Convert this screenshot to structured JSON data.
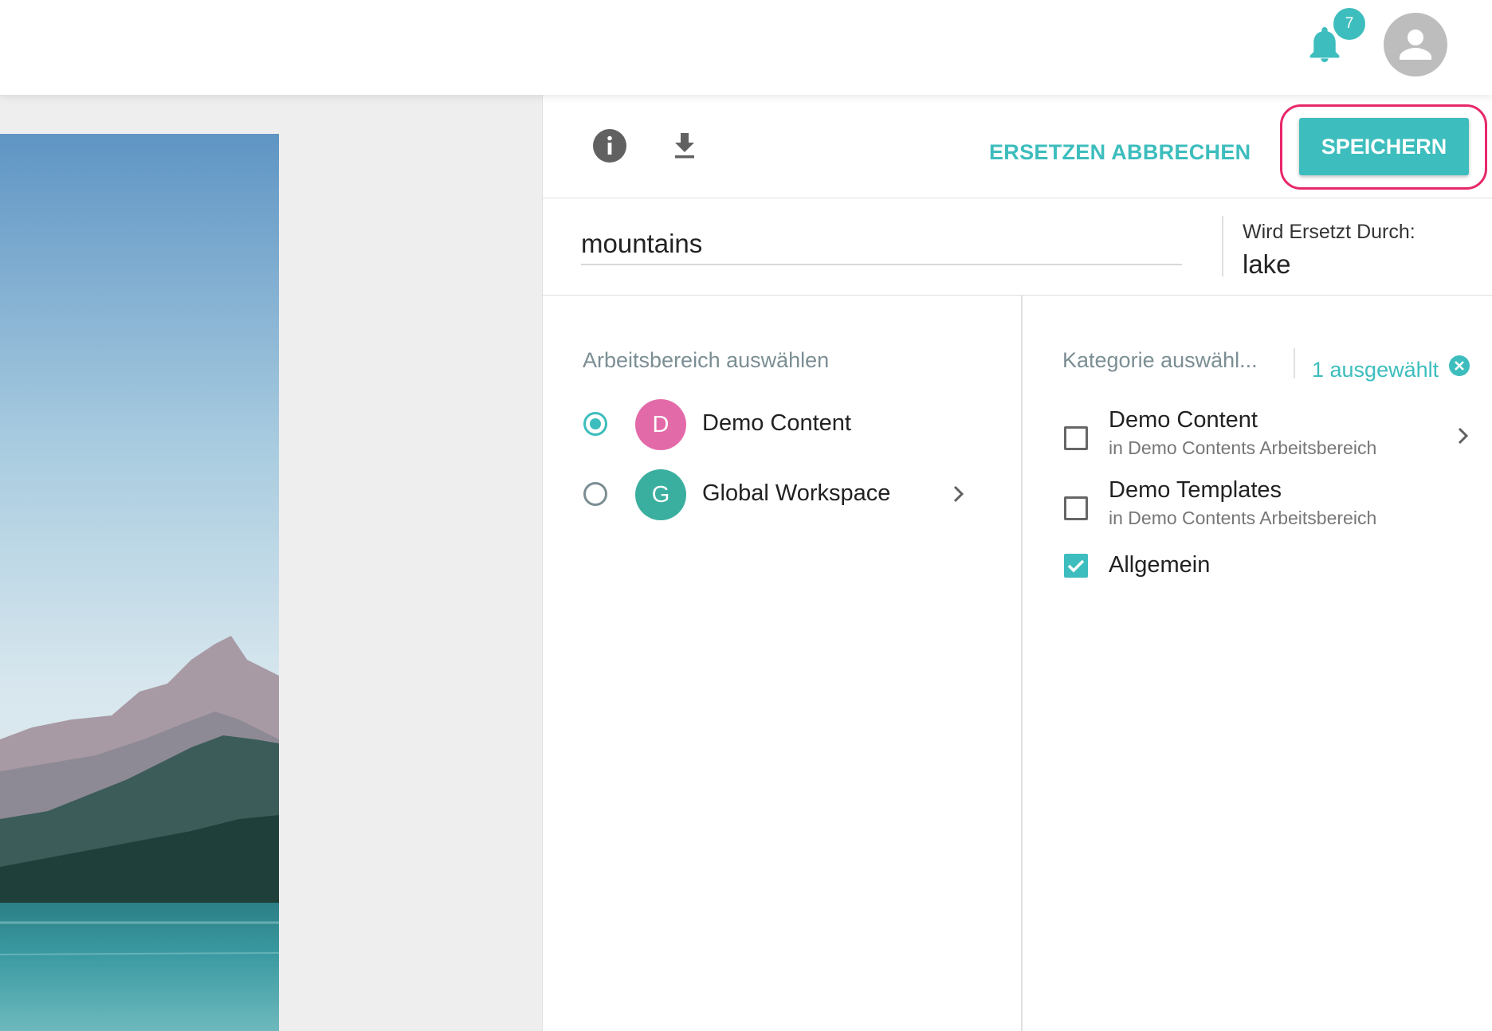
{
  "header": {
    "notification_count": "7",
    "icons": [
      "bell-icon",
      "user-avatar-icon"
    ]
  },
  "toolbar": {
    "cancel_label": "ERSETZEN ABBRECHEN",
    "save_label": "SPEICHERN",
    "icons": [
      "info-icon",
      "download-icon"
    ]
  },
  "asset": {
    "name": "mountains",
    "replace_label": "Wird Ersetzt Durch:",
    "replace_value": "lake"
  },
  "workspace": {
    "title": "Arbeitsbereich auswählen",
    "items": [
      {
        "initial": "D",
        "label": "Demo Content",
        "selected": true,
        "color": "#e36aa8"
      },
      {
        "initial": "G",
        "label": "Global Workspace",
        "selected": false,
        "color": "#3aaf9f"
      }
    ]
  },
  "category": {
    "title": "Kategorie auswähl...",
    "selected_count": "1 ausgewählt",
    "items": [
      {
        "label": "Demo Content",
        "sub": "in Demo Contents Arbeitsbereich",
        "checked": false
      },
      {
        "label": "Demo Templates",
        "sub": "in Demo Contents Arbeitsbereich",
        "checked": false
      },
      {
        "label": "Allgemein",
        "sub": "",
        "checked": true
      }
    ]
  },
  "colors": {
    "accent": "#3dbdbd",
    "highlight": "#e8276b",
    "muted": "#7b8e94"
  }
}
